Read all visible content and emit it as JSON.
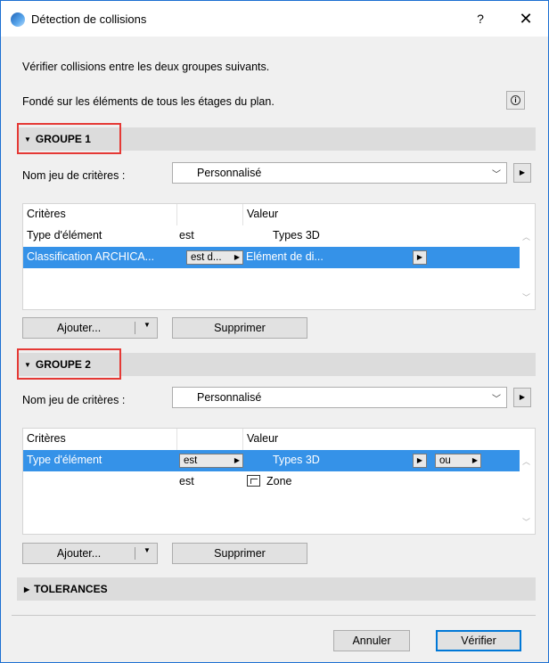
{
  "window": {
    "title": "Détection de collisions",
    "help": "?",
    "close": "✕"
  },
  "intro": {
    "line1": "Vérifier collisions entre les deux groupes suivants.",
    "line2": "Fondé sur les éléments de tous les étages du plan.",
    "info_icon": "i"
  },
  "group1": {
    "label": "GROUPE 1",
    "criteria_set_label": "Nom jeu de critères :",
    "criteria_set_value": "Personnalisé",
    "table": {
      "headers": [
        "Critères",
        "Valeur"
      ],
      "rows": [
        {
          "criterion": "Type d'élément",
          "operator": "est",
          "value": "Types 3D"
        },
        {
          "criterion": "Classification ARCHICA...",
          "operator": "est d...",
          "value": "Elément de di..."
        }
      ]
    },
    "add_label": "Ajouter...",
    "delete_label": "Supprimer"
  },
  "group2": {
    "label": "GROUPE 2",
    "criteria_set_label": "Nom jeu de critères :",
    "criteria_set_value": "Personnalisé",
    "table": {
      "headers": [
        "Critères",
        "Valeur"
      ],
      "rows": [
        {
          "criterion": "Type d'élément",
          "operator": "est",
          "value": "Types 3D",
          "logic": "ou"
        },
        {
          "criterion": "",
          "operator": "est",
          "value": "Zone"
        }
      ]
    },
    "add_label": "Ajouter...",
    "delete_label": "Supprimer"
  },
  "tolerances": {
    "label": "TOLERANCES"
  },
  "footer": {
    "cancel_label": "Annuler",
    "verify_label": "Vérifier"
  },
  "colors": {
    "selection": "#3592e8",
    "highlight_box": "#e53935",
    "primary_border": "#0078d7"
  }
}
